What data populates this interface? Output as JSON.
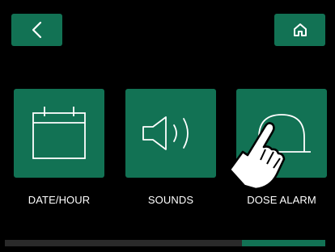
{
  "header": {
    "back_icon": "chevron-left-icon",
    "home_icon": "home-icon"
  },
  "tiles": [
    {
      "label": "DATE/HOUR",
      "icon": "calendar-icon"
    },
    {
      "label": "SOUNDS",
      "icon": "speaker-icon"
    },
    {
      "label": "DOSE ALARM",
      "icon": "bell-icon"
    }
  ],
  "overlay": {
    "icon": "tap-hand-icon"
  },
  "scrollbar": {
    "position_fraction": 0.74,
    "visible_fraction": 0.26
  },
  "colors": {
    "accent": "#127254",
    "background": "#000000",
    "text": "#ffffff"
  }
}
